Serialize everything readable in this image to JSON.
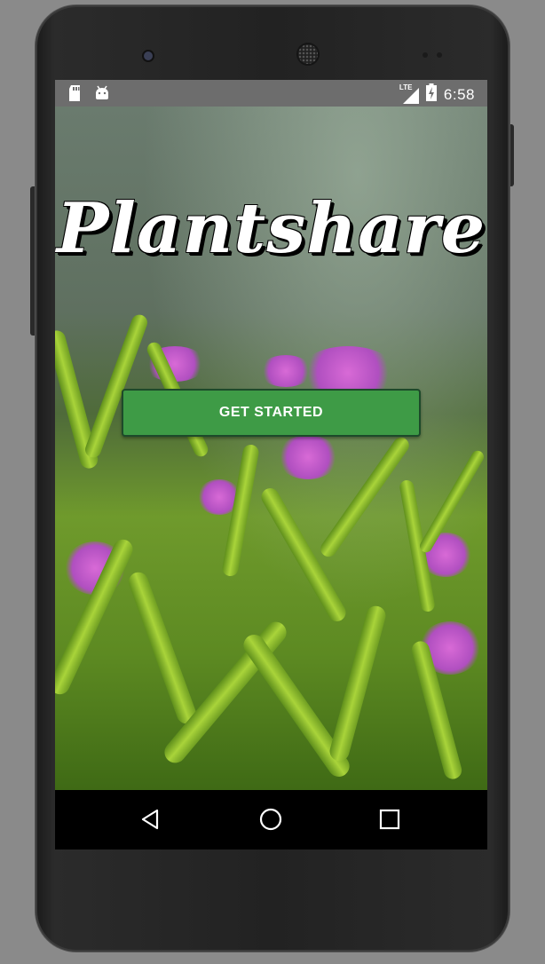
{
  "status_bar": {
    "network": "LTE",
    "time": "6:58",
    "icons": [
      "sd-card-icon",
      "android-icon",
      "lte-signal-icon",
      "battery-charging-icon"
    ]
  },
  "app": {
    "title": "Plantshare",
    "cta_label": "GET STARTED",
    "accent": "#3e9b46",
    "cta_border": "#1d4a2a"
  },
  "nav_bar": {
    "icons": [
      "back-icon",
      "home-icon",
      "recents-icon"
    ]
  }
}
